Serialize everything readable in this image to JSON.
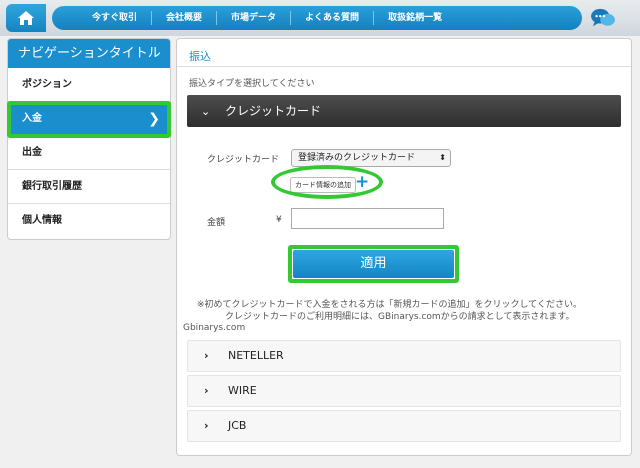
{
  "nav": {
    "items": [
      "今すぐ取引",
      "会社概要",
      "市場データ",
      "よくある質問",
      "取扱銘柄一覧"
    ]
  },
  "sidebar": {
    "title": "ナビゲーションタイトル",
    "items": [
      {
        "label": "ポジション"
      },
      {
        "label": "入金"
      },
      {
        "label": "出金"
      },
      {
        "label": "銀行取引履歴"
      },
      {
        "label": "個人情報"
      }
    ],
    "active_index": 1
  },
  "main": {
    "breadcrumb": "振込",
    "subtitle": "振込タイプを選択してください",
    "credit": {
      "header": "クレジットカード",
      "card_label": "クレジットカード",
      "card_select_value": "登録済みのクレジットカード",
      "add_card_label": "カード情報の追加",
      "amount_label": "金額",
      "currency_symbol": "¥",
      "amount_value": "",
      "apply_label": "適用"
    },
    "notice_line1": "※初めてクレジットカードで入金をされる方は「新規カードの追加」をクリックしてください。",
    "notice_line2": "クレジットカードのご利用明細には、GBinarys.comからの請求として表示されます。",
    "domain_text": "Gbinarys.com",
    "methods": [
      "NETELLER",
      "WIRE",
      "JCB"
    ]
  },
  "colors": {
    "accent": "#1b8fcd",
    "highlight": "#34c934",
    "dark_header": "#3a3a3a"
  }
}
